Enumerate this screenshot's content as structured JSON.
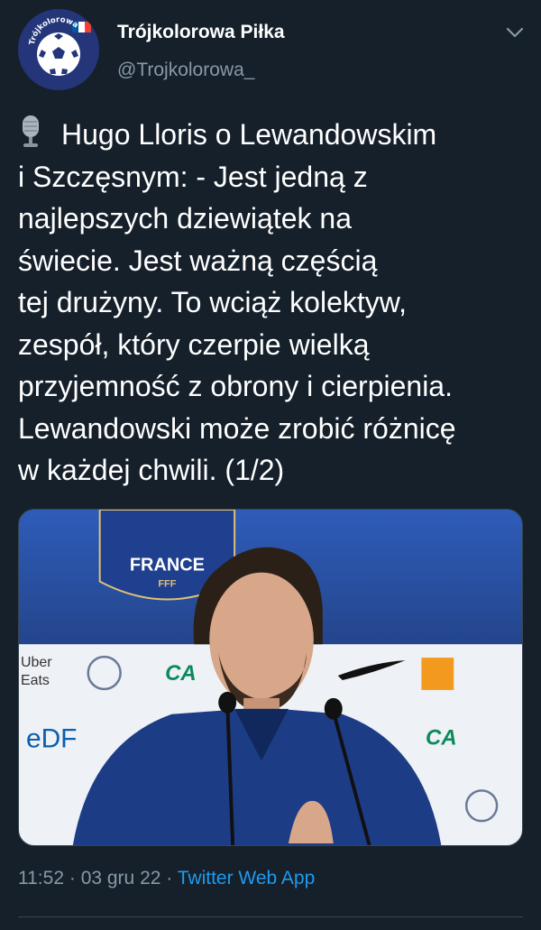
{
  "author": {
    "display_name": "Trójkolorowa Piłka",
    "handle": "@Trojkolorowa_",
    "avatar_icon": "football-icon",
    "avatar_text": "Trójkolorowa Piłka"
  },
  "tweet": {
    "emoji_icon": "microphone-icon",
    "text": "Hugo Lloris o Lewandowskim\ni Szczęsnym: - Jest jedną z\nnajlepszych dziewiątek na\nświecie. Jest ważną częścią\ntej drużyny. To wciąż kolektyw,\nzespół, który czerpie wielką\nprzyjemność z obrony i cierpienia.\nLewandowski może zrobić różnicę\nw każdej chwili. (1/2)",
    "media": {
      "backdrop_text": "FRANCE",
      "backdrop_subtext": "FFF",
      "sponsor_uber": "Uber",
      "sponsor_eats": "Eats",
      "sponsor_edf": "eDF",
      "sponsor_ca": "CA"
    },
    "time": "11:52",
    "date": "03 gru 22",
    "separator": "·",
    "source_app": "Twitter Web App"
  },
  "colors": {
    "background": "#15202b",
    "secondary_text": "#8899a6",
    "link": "#1d9bf0",
    "divider": "#38444d"
  }
}
